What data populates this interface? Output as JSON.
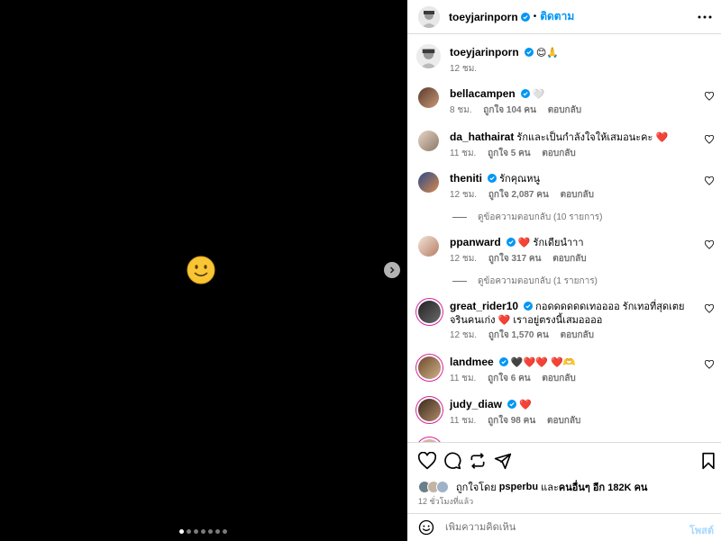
{
  "media": {
    "slide_count": 7,
    "active_slide": 1
  },
  "header": {
    "username": "toeyjarinporn",
    "separator": "•",
    "follow_label": "ติดตาม"
  },
  "caption": {
    "username": "toeyjarinporn",
    "text": "😊🙏",
    "time": "12 ชม."
  },
  "comments": [
    {
      "username": "bellacampen",
      "text": "🤍",
      "time": "8 ชม.",
      "likes": "ถูกใจ 104 คน",
      "reply": "ตอบกลับ"
    },
    {
      "username": "da_hathairat",
      "text": "รักและเป็นกำลังใจให้เสมอนะคะ ❤️",
      "time": "11 ชม.",
      "likes": "ถูกใจ 5 คน",
      "reply": "ตอบกลับ"
    },
    {
      "username": "theniti",
      "text": "รักคุณหนู",
      "time": "12 ชม.",
      "likes": "ถูกใจ 2,087 คน",
      "reply": "ตอบกลับ",
      "view_replies": "ดูข้อความตอบกลับ (10 รายการ)"
    },
    {
      "username": "ppanward",
      "text": "❤️ รักเดียนำาา",
      "time": "12 ชม.",
      "likes": "ถูกใจ 317 คน",
      "reply": "ตอบกลับ",
      "view_replies": "ดูข้อความตอบกลับ (1 รายการ)"
    },
    {
      "username": "great_rider10",
      "text": "กอดดดดดดเทออออ รักเทอที่สุดเตยจรินคนเก่ง ❤️ เราอยู่ตรงนี้เสมออออ",
      "time": "12 ชม.",
      "likes": "ถูกใจ 1,570 คน",
      "reply": "ตอบกลับ"
    },
    {
      "username": "landmee",
      "text": "🖤❤️❤️ ❤️🫶",
      "time": "11 ชม.",
      "likes": "ถูกใจ 6 คน",
      "reply": "ตอบกลับ"
    },
    {
      "username": "judy_diaw",
      "text": "❤️",
      "time": "11 ชม.",
      "likes": "ถูกใจ 98 คน",
      "reply": "ตอบกลับ"
    }
  ],
  "likes": {
    "prefix": "ถูกใจโดย",
    "user": "psperbu",
    "middle": "และ",
    "others": "คนอื่นๆ อีก 182K คน"
  },
  "time_ago": "12 ชั่วโมงที่แล้ว",
  "add_comment": {
    "placeholder": "เพิ่มความคิดเห็น",
    "post_label": "โพสต์"
  },
  "colors": {
    "link_blue": "#0095f6",
    "verified_blue": "#0095f6",
    "heart_red": "#ed4956",
    "muted_text": "#737373"
  }
}
